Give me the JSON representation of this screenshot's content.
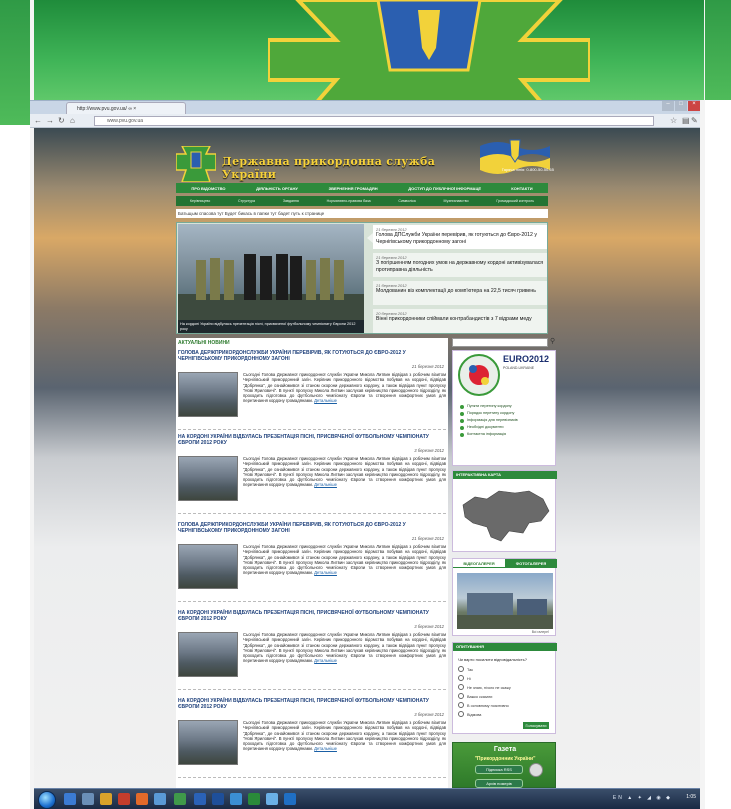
{
  "browser": {
    "tab_title": "http://www.pvu.gov.ua/ ∞ ×",
    "address": "www.pvu.gov.ua"
  },
  "site": {
    "title": "Державна прикордонна служба України",
    "hotline": "Гаряча лінія: 0-800-50-50-65",
    "menu_main": [
      "ПРО ВІДОМСТВО",
      "ДІЯЛЬНІСТЬ ОРГАНУ",
      "ЗВЕРНЕННЯ ГРОМАДЯН",
      "ДОСТУП ДО ПУБЛІЧНОЇ ІНФОРМАЦІЇ",
      "КОНТАКТИ"
    ],
    "menu_sub": [
      "Керівництво",
      "Структура",
      "Завдання",
      "Нормативно-правова база",
      "Символіка",
      "Музеєзнавство",
      "Громадський контроль"
    ],
    "breadcrumb": "Батьщым cпасова тут Будет бикась в папки тут бадет путь к странице"
  },
  "slider": {
    "caption": "На кордоні України відбулась презентація пісні, присвяченої футбольному чемпіонату Європи 2012 року",
    "items": [
      {
        "date": "21 березня 2012",
        "title": "Голова ДПСлужби України перевірив, як готуються до Євро-2012 у Чернігівському прикордонному загоні"
      },
      {
        "date": "21 березня 2012",
        "title": "З погіршенням погодних умов на державному кордоні активізувалася протиправна діяльність"
      },
      {
        "date": "21 березня 2012",
        "title": "Молдованин віз комплектації до комп'ютера на 22,5 тисяч гривень"
      },
      {
        "date": "20 березня 2012",
        "title": "Вінні прикордонники спіймали контрабандистів з 7 відрами меду"
      }
    ]
  },
  "news": {
    "section_title": "АКТУАЛЬНІ НОВИНИ",
    "items": [
      {
        "title": "Голова Держприкордонслужби України перевірив, як готуються до Євро-2012 у Чернігівському прикордонному загоні",
        "date": "21 березня 2012",
        "body": "Сьогодні Голова Державної прикордонної служби України Микола Литвин відвідав з робочим візитом Чернігівський прикордонний загін. Керівник прикордонного відомства побував на кордоні, відвідав \"Добрянка\", де ознайомився зі станом охорони державного кордону, а також відвідав пункт пропуску \"Нові Яриловичі\". В пункті пропуску Микола Литвин заслухав керівництво прикордонного підрозділу, як проходить підготовка до футбольного чемпіонату Європи та створення комфортних умов для перетинання кордону громадянами.",
        "more": "Детальніше"
      },
      {
        "title": "На кордоні України відбулась презентація пісні, присвяченої футбольному чемпіонату Європи 2012 року",
        "date": "3 березня 2012",
        "body": "Сьогодні Голова Державної прикордонної служби України Микола Литвин відвідав з робочим візитом Чернігівський прикордонний загін. Керівник прикордонного відомства побував на кордоні, відвідав \"Добрянка\", де ознайомився зі станом охорони державного кордону, а також відвідав пункт пропуску \"Нові Яриловичі\". В пункті пропуску Микола Литвин заслухав керівництво прикордонного підрозділу, як проходить підготовка до футбольного чемпіонату Європи та створення комфортних умов для перетинання кордону громадянами.",
        "more": "Детальніше"
      },
      {
        "title": "Голова Держприкордонслужби України перевірив, як готуються до Євро-2012 у Чернігівському прикордонному загоні",
        "date": "21 березня 2012",
        "body": "Сьогодні Голова Державної прикордонної служби України Микола Литвин відвідав з робочим візитом Чернігівський прикордонний загін. Керівник прикордонного відомства побував на кордоні, відвідав \"Добрянка\", де ознайомився зі станом охорони державного кордону, а також відвідав пункт пропуску \"Нові Яриловичі\". В пункті пропуску Микола Литвин заслухав керівництво прикордонного підрозділу, як проходить підготовка до футбольного чемпіонату Європи та створення комфортних умов для перетинання кордону громадянами.",
        "more": "Детальніше"
      },
      {
        "title": "На кордоні України відбулась презентація пісні, присвяченої футбольному чемпіонату Європи 2012 року",
        "date": "3 березня 2012",
        "body": "Сьогодні Голова Державної прикордонної служби України Микола Литвин відвідав з робочим візитом Чернігівський прикордонний загін. Керівник прикордонного відомства побував на кордоні, відвідав \"Добрянка\", де ознайомився зі станом охорони державного кордону, а також відвідав пункт пропуску \"Нові Яриловичі\". В пункті пропуску Микола Литвин заслухав керівництво прикордонного підрозділу, як проходить підготовка до футбольного чемпіонату Європи та створення комфортних умов для перетинання кордону громадянами.",
        "more": "Детальніше"
      },
      {
        "title": "На кордоні України відбулась презентація пісні, присвяченої футбольному чемпіонату Європи 2012 року",
        "date": "3 березня 2012",
        "body": "Сьогодні Голова Державної прикордонної служби України Микола Литвин відвідав з робочим візитом Чернігівський прикордонний загін. Керівник прикордонного відомства побував на кордоні, відвідав \"Добрянка\", де ознайомився зі станом охорони державного кордону, а також відвідав пункт пропуску \"Нові Яриловичі\". В пункті пропуску Микола Литвин заслухав керівництво прикордонного підрозділу, як проходить підготовка до футбольного чемпіонату Європи та створення комфортних умов для перетинання кордону громадянами.",
        "more": "Детальніше"
      }
    ]
  },
  "sidebar": {
    "euro_title": "EURO2012",
    "euro_sub": "POLAND-UKRAINE",
    "links": [
      "Пункти перетину кордону",
      "Порядок перетину кордону",
      "Інформація для перевізників",
      "Необхідні документи",
      "Контактна інформація"
    ],
    "map_title": "ІНТЕРАКТИВНА КАРТА",
    "video_tab": "ВІДЕОГАЛЕРЕЯ",
    "photo_tab": "ФОТОГАЛЕРЕЯ",
    "video_caption": "Всі галереї",
    "poll_title": "ОПИТУВАННЯ",
    "poll_question": "Чи варто посилити відповідальність?",
    "poll_options": [
      "Так",
      "Ні",
      "Не знаю, нічого не скажу",
      "Важко сказати",
      "В основному позитивно",
      "Відмова"
    ],
    "vote_label": "Голосувати",
    "gazeta_title": "Газета",
    "gazeta_name": "\"Прикордонник України\"",
    "rss_label": "Підписка RSS",
    "archive_label": "Архів номерів"
  },
  "taskbar": {
    "tray": "EN ▲ ✦ ◢ ◉ ◆",
    "clock": "1:05"
  },
  "colors": {
    "brand_green": "#2d8a3c",
    "title_gold": "#f7d23a",
    "news_title_blue": "#1d3f7a"
  }
}
